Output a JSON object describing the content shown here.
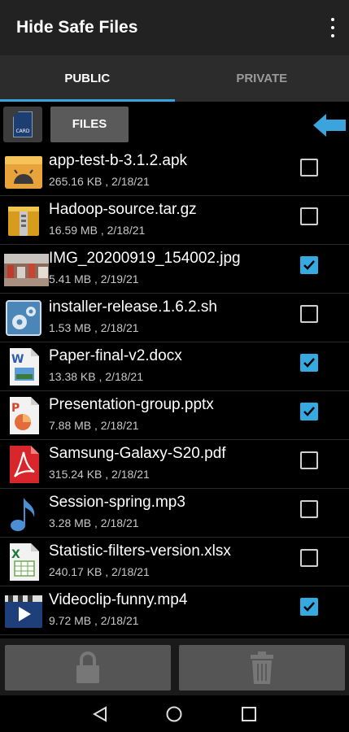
{
  "app": {
    "title": "Hide Safe Files"
  },
  "tabs": [
    {
      "label": "PUBLIC"
    },
    {
      "label": "PRIVATE"
    }
  ],
  "toolbar": {
    "files_label": "FILES",
    "sd_card_text": "CARD"
  },
  "files": [
    {
      "name": "app-test-b-3.1.2.apk",
      "meta": "265.16 KB , 2/18/21",
      "icon": "apk-android-icon",
      "checked": false
    },
    {
      "name": "Hadoop-source.tar.gz",
      "meta": "16.59 MB , 2/18/21",
      "icon": "archive-icon",
      "checked": false
    },
    {
      "name": "IMG_20200919_154002.jpg",
      "meta": "5.41 MB , 2/19/21",
      "icon": "photo-thumbnail",
      "checked": true
    },
    {
      "name": "installer-release.1.6.2.sh",
      "meta": "1.53 MB , 2/18/21",
      "icon": "script-gears-icon",
      "checked": false
    },
    {
      "name": "Paper-final-v2.docx",
      "meta": "13.38 KB , 2/18/21",
      "icon": "word-doc-icon",
      "checked": true
    },
    {
      "name": "Presentation-group.pptx",
      "meta": "7.88 MB , 2/18/21",
      "icon": "powerpoint-icon",
      "checked": true
    },
    {
      "name": "Samsung-Galaxy-S20.pdf",
      "meta": "315.24 KB , 2/18/21",
      "icon": "pdf-icon",
      "checked": false
    },
    {
      "name": "Session-spring.mp3",
      "meta": "3.28 MB , 2/18/21",
      "icon": "music-note-icon",
      "checked": false
    },
    {
      "name": "Statistic-filters-version.xlsx",
      "meta": "240.17 KB , 2/18/21",
      "icon": "excel-icon",
      "checked": false
    },
    {
      "name": "Videoclip-funny.mp4",
      "meta": "9.72 MB , 2/18/21",
      "icon": "video-icon",
      "checked": true
    }
  ],
  "bottom": {
    "lock_icon": "lock-icon",
    "trash_icon": "trash-icon"
  },
  "nav": {
    "back": "back-triangle-icon",
    "home": "home-circle-icon",
    "recents": "recents-square-icon"
  },
  "colors": {
    "accent": "#33a7dd",
    "checkbox_checked": "#36a9e1"
  }
}
